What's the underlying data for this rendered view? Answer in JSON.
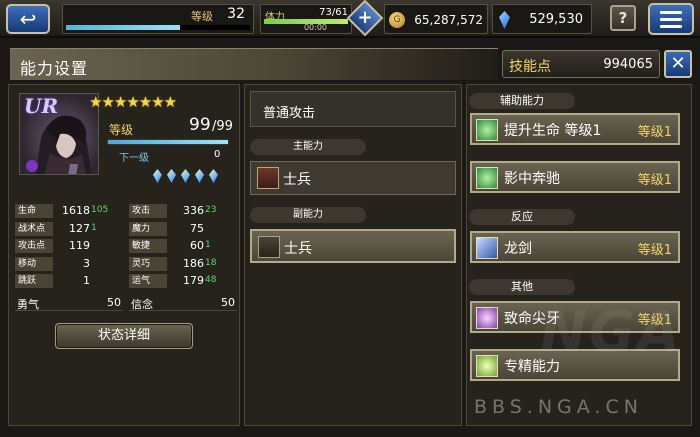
{
  "top_bar": {
    "level_label": "等级",
    "level_value": "32",
    "level_progress": 0.62,
    "stamina_label": "体力",
    "stamina_value": "73/61",
    "stamina_timer": "00:00",
    "stamina_progress": 1.0,
    "gil_value": "65,287,572",
    "gil_icon_glyph": "G",
    "gems_value": "529,530",
    "help_glyph": "?",
    "back_glyph": "↩",
    "plus_glyph": "+"
  },
  "header": {
    "title": "能力设置",
    "skill_points_label": "技能点",
    "skill_points_value": "994065",
    "close_glyph": "✕"
  },
  "character": {
    "rarity": "UR",
    "stars": "★★★★★★★",
    "level_label": "等级",
    "level": "99",
    "level_max": "/99",
    "next_label": "下一级",
    "next_value": "0",
    "crystal_count": 5,
    "stats": [
      {
        "left_key": "生命",
        "left_val": "1618",
        "left_bonus": "105",
        "right_key": "攻击",
        "right_val": "336",
        "right_bonus": "23"
      },
      {
        "left_key": "战术点",
        "left_val": "127",
        "left_bonus": "1",
        "right_key": "魔力",
        "right_val": "75",
        "right_bonus": ""
      },
      {
        "left_key": "攻击点",
        "left_val": "119",
        "left_bonus": "",
        "right_key": "敏捷",
        "right_val": "60",
        "right_bonus": "1"
      },
      {
        "left_key": "移动",
        "left_val": "3",
        "left_bonus": "",
        "right_key": "灵巧",
        "right_val": "186",
        "right_bonus": "18"
      },
      {
        "left_key": "跳跃",
        "left_val": "1",
        "left_bonus": "",
        "right_key": "运气",
        "right_val": "179",
        "right_bonus": "48"
      }
    ],
    "bravery_label": "勇气",
    "bravery_value": "50",
    "faith_label": "信念",
    "faith_value": "50",
    "detail_button": "状态详细"
  },
  "abilities": {
    "normal_attack": "普通攻击",
    "primary_label": "主能力",
    "primary_value": "士兵",
    "secondary_label": "副能力",
    "secondary_value": "士兵"
  },
  "support": {
    "section_label": "辅助能力",
    "items": [
      {
        "name": "提升生命 等级1",
        "level": "等级1"
      },
      {
        "name": "影中奔驰",
        "level": "等级1"
      }
    ],
    "reaction_label": "反应",
    "reaction": {
      "name": "龙剑",
      "level": "等级1"
    },
    "other_label": "其他",
    "other": [
      {
        "name": "致命尖牙",
        "level": "等级1"
      },
      {
        "name": "专精能力",
        "level": ""
      }
    ]
  },
  "watermark": {
    "text": "BBS.NGA.CN",
    "big_text": "NGA"
  }
}
